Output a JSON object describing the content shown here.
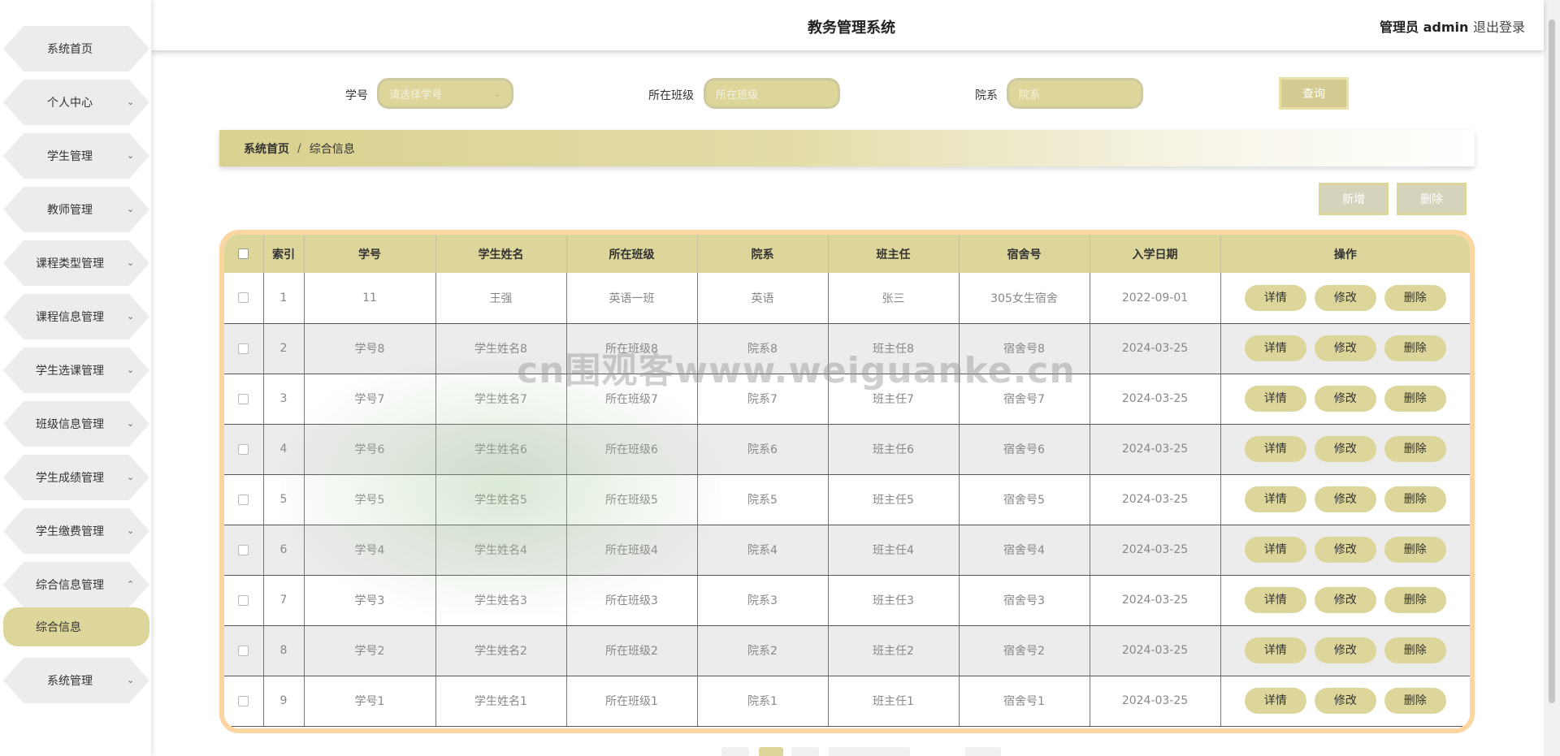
{
  "header": {
    "title": "教务管理系统",
    "user": "管理员 admin",
    "logout": "退出登录"
  },
  "sidebar": {
    "items": [
      {
        "label": "系统首页",
        "chevron": ""
      },
      {
        "label": "个人中心",
        "chevron": "⌄"
      },
      {
        "label": "学生管理",
        "chevron": "⌄"
      },
      {
        "label": "教师管理",
        "chevron": "⌄"
      },
      {
        "label": "课程类型管理",
        "chevron": "⌄"
      },
      {
        "label": "课程信息管理",
        "chevron": "⌄"
      },
      {
        "label": "学生选课管理",
        "chevron": "⌄"
      },
      {
        "label": "班级信息管理",
        "chevron": "⌄"
      },
      {
        "label": "学生成绩管理",
        "chevron": "⌄"
      },
      {
        "label": "学生缴费管理",
        "chevron": "⌄"
      },
      {
        "label": "综合信息管理",
        "chevron": "⌃"
      },
      {
        "label": "系统管理",
        "chevron": "⌄"
      }
    ],
    "active_sub": "综合信息"
  },
  "search": {
    "student_no_label": "学号",
    "student_no_placeholder": "请选择学号",
    "class_label": "所在班级",
    "class_placeholder": "所在班级",
    "dept_label": "院系",
    "dept_placeholder": "院系",
    "query_label": "查询"
  },
  "breadcrumb": {
    "home": "系统首页",
    "separator": "/",
    "current": "综合信息"
  },
  "actions": {
    "add_label": "新增",
    "delete_label": "删除"
  },
  "table": {
    "columns": [
      "索引",
      "学号",
      "学生姓名",
      "所在班级",
      "院系",
      "班主任",
      "宿舍号",
      "入学日期",
      "操作"
    ],
    "row_actions": {
      "detail": "详情",
      "edit": "修改",
      "delete": "删除"
    },
    "rows": [
      {
        "index": "1",
        "student_no": "11",
        "name": "王强",
        "class": "英语一班",
        "dept": "英语",
        "head_teacher": "张三",
        "dorm": "305女生宿舍",
        "date": "2022-09-01"
      },
      {
        "index": "2",
        "student_no": "学号8",
        "name": "学生姓名8",
        "class": "所在班级8",
        "dept": "院系8",
        "head_teacher": "班主任8",
        "dorm": "宿舍号8",
        "date": "2024-03-25"
      },
      {
        "index": "3",
        "student_no": "学号7",
        "name": "学生姓名7",
        "class": "所在班级7",
        "dept": "院系7",
        "head_teacher": "班主任7",
        "dorm": "宿舍号7",
        "date": "2024-03-25"
      },
      {
        "index": "4",
        "student_no": "学号6",
        "name": "学生姓名6",
        "class": "所在班级6",
        "dept": "院系6",
        "head_teacher": "班主任6",
        "dorm": "宿舍号6",
        "date": "2024-03-25"
      },
      {
        "index": "5",
        "student_no": "学号5",
        "name": "学生姓名5",
        "class": "所在班级5",
        "dept": "院系5",
        "head_teacher": "班主任5",
        "dorm": "宿舍号5",
        "date": "2024-03-25"
      },
      {
        "index": "6",
        "student_no": "学号4",
        "name": "学生姓名4",
        "class": "所在班级4",
        "dept": "院系4",
        "head_teacher": "班主任4",
        "dorm": "宿舍号4",
        "date": "2024-03-25"
      },
      {
        "index": "7",
        "student_no": "学号3",
        "name": "学生姓名3",
        "class": "所在班级3",
        "dept": "院系3",
        "head_teacher": "班主任3",
        "dorm": "宿舍号3",
        "date": "2024-03-25"
      },
      {
        "index": "8",
        "student_no": "学号2",
        "name": "学生姓名2",
        "class": "所在班级2",
        "dept": "院系2",
        "head_teacher": "班主任2",
        "dorm": "宿舍号2",
        "date": "2024-03-25"
      },
      {
        "index": "9",
        "student_no": "学号1",
        "name": "学生姓名1",
        "class": "所在班级1",
        "dept": "院系1",
        "head_teacher": "班主任1",
        "dorm": "宿舍号1",
        "date": "2024-03-25"
      }
    ]
  },
  "watermark": "cn围观客www.weiguanke.cn",
  "colors": {
    "accent": "#ddd69a",
    "table_border": "#fcd6a1",
    "row_alt": "#ececec"
  }
}
